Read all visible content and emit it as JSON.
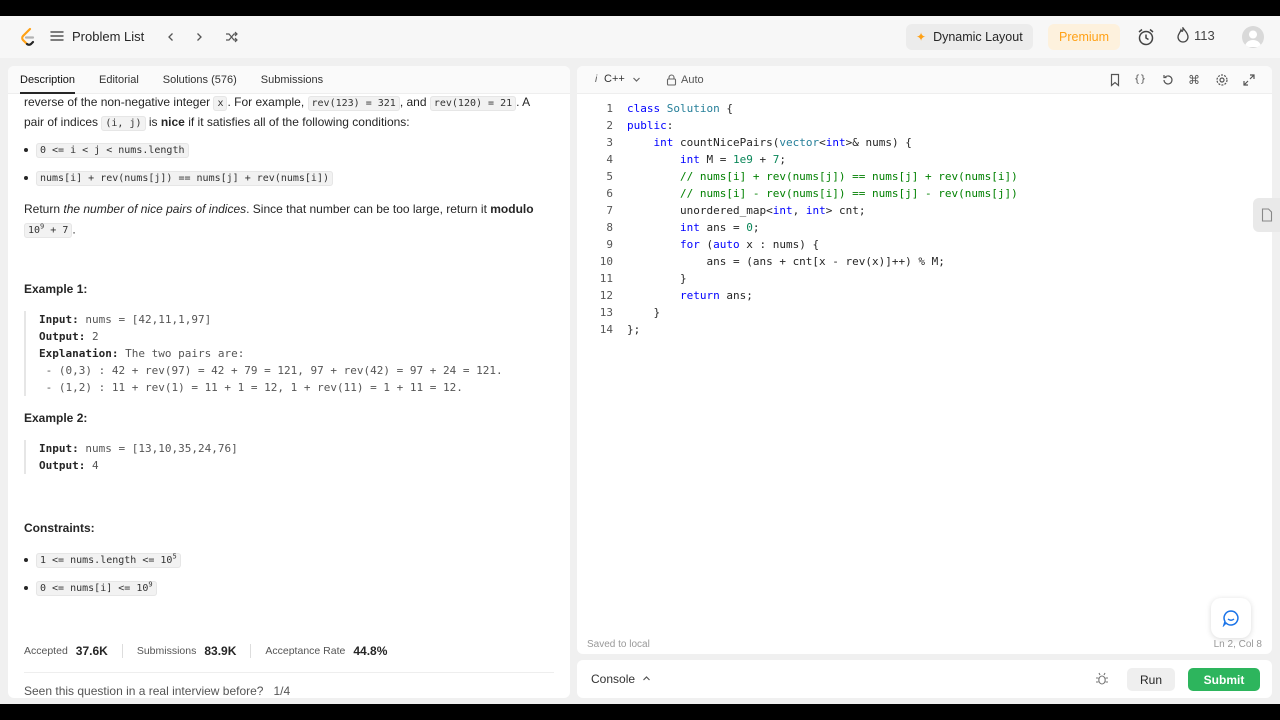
{
  "nav": {
    "title": "Problem List",
    "dynamic_layout": "Dynamic Layout",
    "premium": "Premium",
    "streak": "113"
  },
  "tabs": [
    "Description",
    "Editorial",
    "Solutions (576)",
    "Submissions"
  ],
  "description": {
    "p1_a": "reverse of the non-negative integer ",
    "p1_code_x": "x",
    "p1_b": ". For example, ",
    "p1_code_1": "rev(123) = 321",
    "p1_c": ", and ",
    "p1_code_2": "rev(120) = 21",
    "p1_d": ". A",
    "p2_a": "pair of indices ",
    "p2_code": "(i, j)",
    "p2_b": " is ",
    "p2_nice": "nice",
    "p2_c": " if it satisfies all of the following conditions:",
    "cond1": "0 <= i < j < nums.length",
    "cond2": "nums[i] + rev(nums[j]) == nums[j] + rev(nums[i])",
    "ret_a": "Return ",
    "ret_em": "the number of nice pairs of indices",
    "ret_b": ". Since that number can be too large, return it ",
    "ret_mod": "modulo",
    "ret_code_base": "10",
    "ret_code_exp": "9",
    "ret_code_rest": " + 7",
    "ret_end": "."
  },
  "examples": [
    {
      "heading": "Example 1:",
      "input_label": "Input:",
      "input": " nums = [42,11,1,97]",
      "output_label": "Output:",
      "output": " 2",
      "expl_label": "Explanation:",
      "expl": " The two pairs are:",
      "lines": [
        " - (0,3) : 42 + rev(97) = 42 + 79 = 121, 97 + rev(42) = 97 + 24 = 121.",
        " - (1,2) : 11 + rev(1) = 11 + 1 = 12, 1 + rev(11) = 1 + 11 = 12."
      ]
    },
    {
      "heading": "Example 2:",
      "input_label": "Input:",
      "input": " nums = [13,10,35,24,76]",
      "output_label": "Output:",
      "output": " 4"
    }
  ],
  "constraints": {
    "heading": "Constraints:",
    "c1_base": "1 <= nums.length <= 10",
    "c1_exp": "5",
    "c2_base": "0 <= nums[i] <= 10",
    "c2_exp": "9"
  },
  "stats": {
    "accepted_label": "Accepted",
    "accepted": "37.6K",
    "submissions_label": "Submissions",
    "submissions": "83.9K",
    "rate_label": "Acceptance Rate",
    "rate": "44.8%"
  },
  "seen": {
    "question": "Seen this question in a real interview before?",
    "count": "1/4"
  },
  "editor": {
    "language": "C++",
    "mode": "Auto",
    "saved": "Saved to local",
    "position": "Ln 2, Col 8"
  },
  "code_lines": [
    "1",
    "2",
    "3",
    "4",
    "5",
    "6",
    "7",
    "8",
    "9",
    "10",
    "11",
    "12",
    "13",
    "14"
  ],
  "console": {
    "label": "Console",
    "run": "Run",
    "submit": "Submit"
  },
  "colors": {
    "accent": "#ffa116",
    "submit": "#2db55d"
  }
}
